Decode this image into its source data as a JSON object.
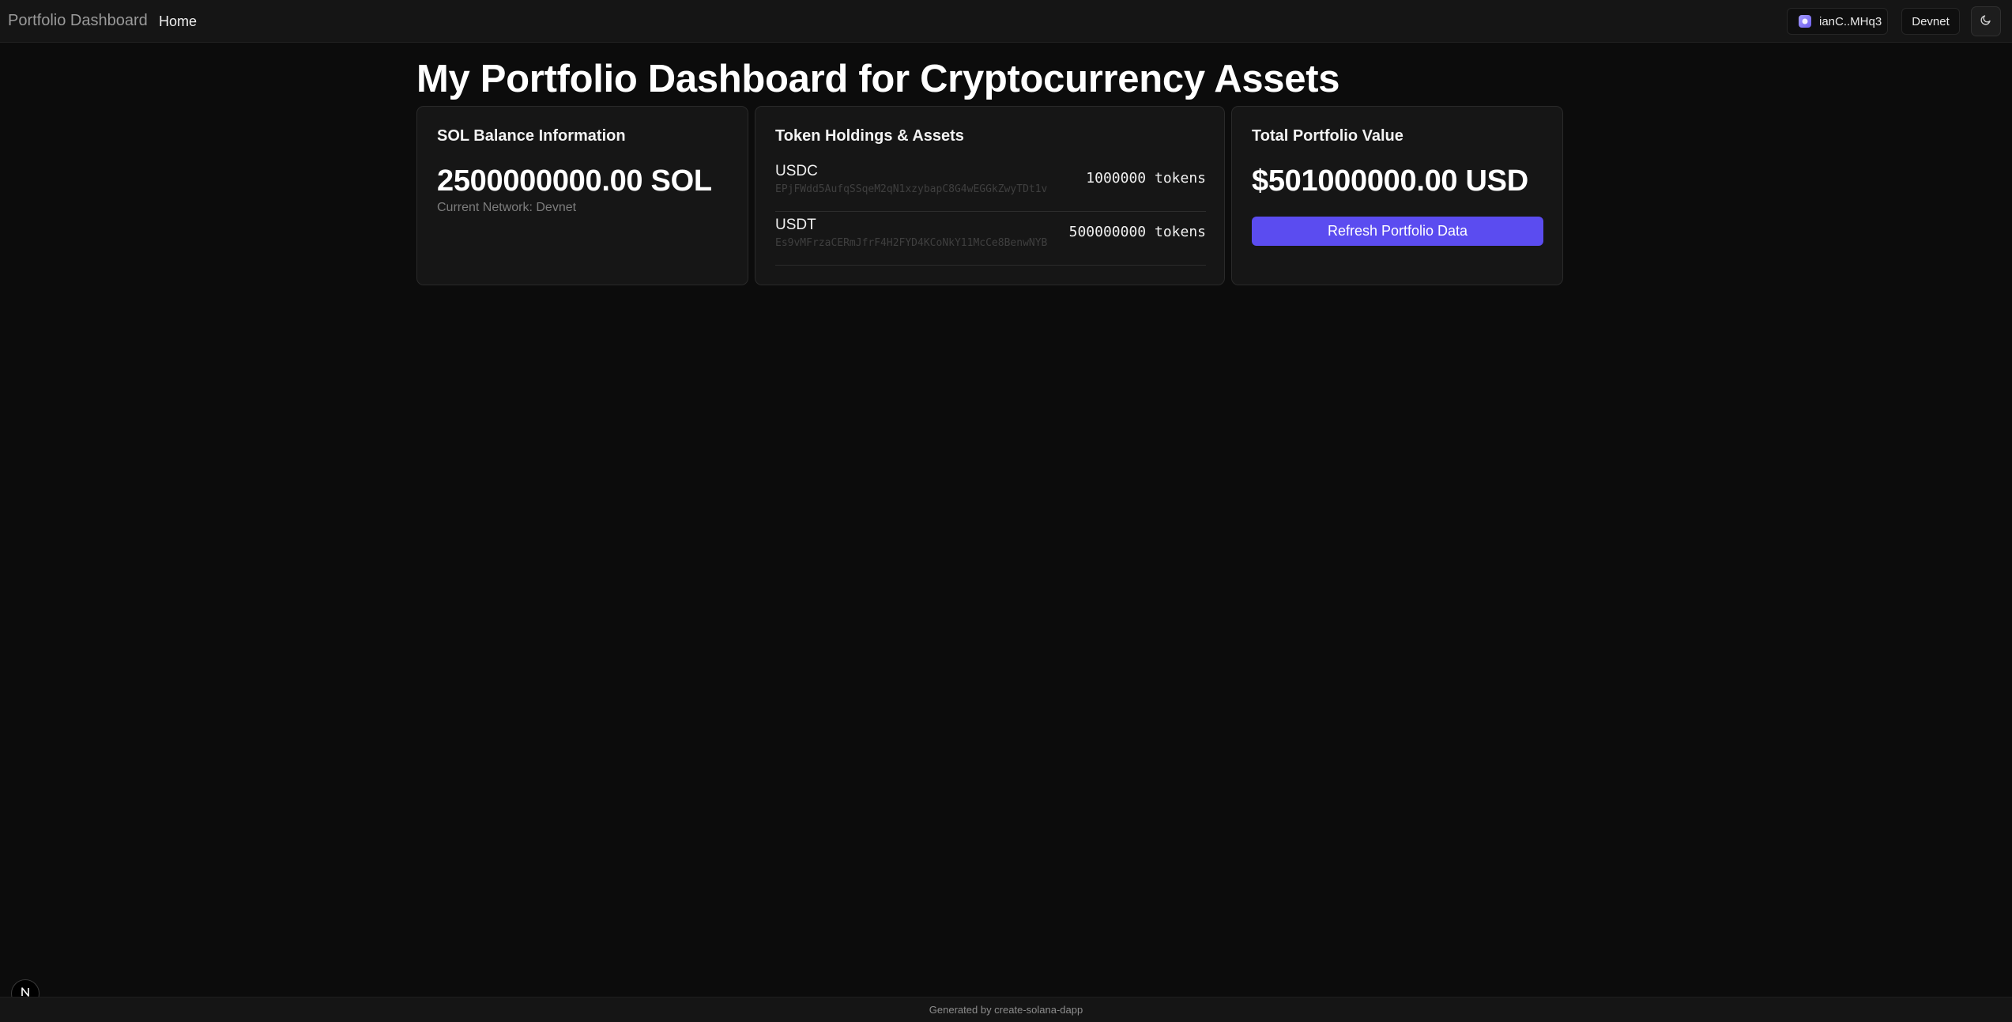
{
  "header": {
    "brand": "Portfolio Dashboard",
    "nav": [
      {
        "label": "Home"
      }
    ],
    "wallet": {
      "label": "ianC..MHq3",
      "icon": "wallet-icon"
    },
    "network": {
      "label": "Devnet"
    },
    "theme_toggle": {
      "icon": "moon-icon"
    }
  },
  "main": {
    "title": "My Portfolio Dashboard for Cryptocurrency Assets",
    "sol_card": {
      "title": "SOL Balance Information",
      "amount": "2500000000.00 SOL",
      "network_line": "Current Network: Devnet"
    },
    "tokens_card": {
      "title": "Token Holdings & Assets",
      "tokens": [
        {
          "symbol": "USDC",
          "mint": "EPjFWdd5AufqSSqeM2qN1xzybapC8G4wEGGkZwyTDt1v",
          "amount": "1000000 tokens"
        },
        {
          "symbol": "USDT",
          "mint": "Es9vMFrzaCERmJfrF4H2FYD4KCoNkY11McCe8BenwNYB",
          "amount": "500000000 tokens"
        }
      ]
    },
    "total_card": {
      "title": "Total Portfolio Value",
      "amount": "$501000000.00 USD",
      "refresh_label": "Refresh Portfolio Data"
    }
  },
  "footer": {
    "text": "Generated by create-solana-dapp"
  },
  "colors": {
    "accent": "#5b4cf0",
    "background": "#0c0c0c",
    "card": "#161616"
  }
}
